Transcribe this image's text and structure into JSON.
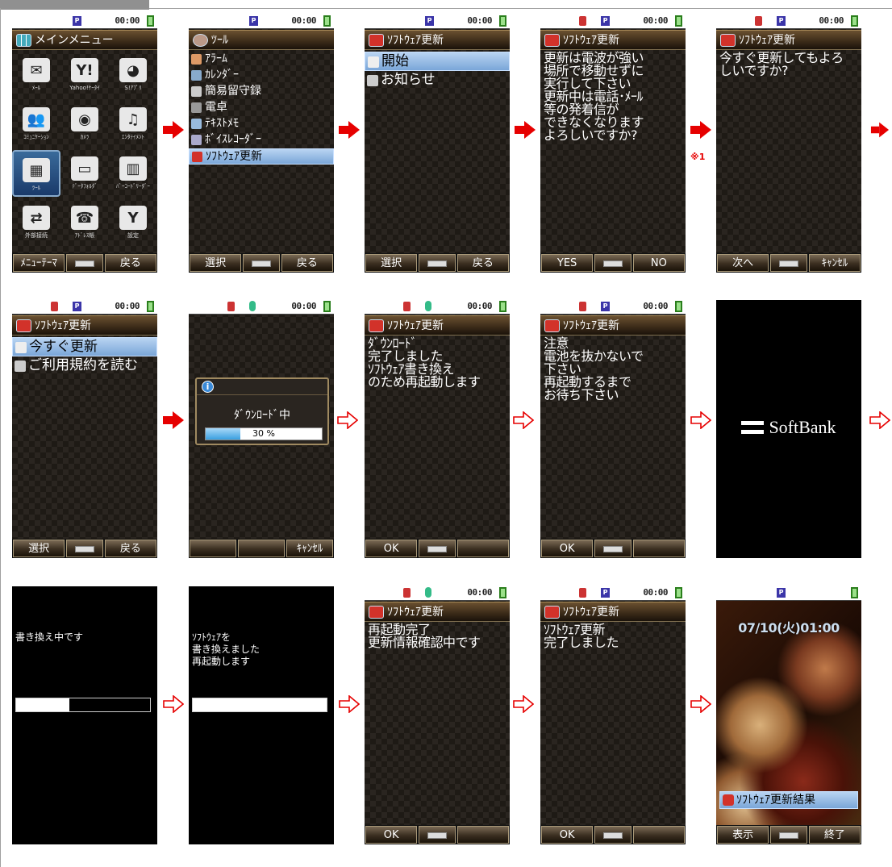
{
  "status": {
    "time": "00:00"
  },
  "screens": {
    "s1": {
      "title": "メインメニュー",
      "items": [
        {
          "label": "ﾒｰﾙ",
          "icon": "envelope-icon",
          "glyph": "✉"
        },
        {
          "label": "Yahoo!ｹｰﾀｲ",
          "icon": "yahoo-icon",
          "glyph": "Y!"
        },
        {
          "label": "S!ｱﾌﾟﾘ",
          "icon": "gamepad-icon",
          "glyph": "◕"
        },
        {
          "label": "ｺﾐｭﾆｹｰｼｮﾝ",
          "icon": "people-icon",
          "glyph": "👥"
        },
        {
          "label": "ｶﾒﾗ",
          "icon": "camera-icon",
          "glyph": "◉"
        },
        {
          "label": "ｴﾝﾀﾃｲﾒﾝﾄ",
          "icon": "headphones-icon",
          "glyph": "♫"
        },
        {
          "label": "ﾂｰﾙ",
          "icon": "tool-icon",
          "glyph": "▦"
        },
        {
          "label": "ﾃﾞｰﾀﾌｫﾙﾀﾞ",
          "icon": "folder-icon",
          "glyph": "▭"
        },
        {
          "label": "ﾊﾞｰｺｰﾄﾞﾘｰﾀﾞｰ",
          "icon": "barcode-icon",
          "glyph": "▥"
        },
        {
          "label": "外部接続",
          "icon": "transfer-icon",
          "glyph": "⇄"
        },
        {
          "label": "ｱﾄﾞﾚｽ帳",
          "icon": "addressbook-icon",
          "glyph": "☎"
        },
        {
          "label": "設定",
          "icon": "wrench-icon",
          "glyph": "Y"
        }
      ],
      "softkeys": [
        "ﾒﾆｭｰﾃｰﾏ",
        "",
        "戻る"
      ]
    },
    "s2": {
      "title": "ﾂｰﾙ",
      "items": [
        "ｱﾗｰﾑ",
        "ｶﾚﾝﾀﾞｰ",
        "簡易留守録",
        "電卓",
        "ﾃｷｽﾄﾒﾓ",
        "ﾎﾞｲｽﾚｺｰﾀﾞｰ",
        "ｿﾌﾄｳｪｱ更新"
      ],
      "softkeys": [
        "選択",
        "",
        "戻る"
      ]
    },
    "s3": {
      "title": "ｿﾌﾄｳｪｱ更新",
      "items": [
        "開始",
        "お知らせ"
      ],
      "softkeys": [
        "選択",
        "",
        "戻る"
      ]
    },
    "s4": {
      "title": "ｿﾌﾄｳｪｱ更新",
      "body": "更新は電波が強い\n場所で移動せずに\n実行して下さい\n更新中は電話･ﾒｰﾙ\n等の発着信が\nできなくなります\nよろしいですか?",
      "softkeys": [
        "YES",
        "",
        "NO"
      ]
    },
    "s5": {
      "title": "ｿﾌﾄｳｪｱ更新",
      "body": "今すぐ更新してもよろ\nしいですか?",
      "softkeys": [
        "次へ",
        "",
        "ｷｬﾝｾﾙ"
      ]
    },
    "s6": {
      "title": "ｿﾌﾄｳｪｱ更新",
      "items": [
        "今すぐ更新",
        "ご利用規約を読む"
      ],
      "softkeys": [
        "選択",
        "",
        "戻る"
      ]
    },
    "s7": {
      "dialog_message": "ﾀﾞｳﾝﾛｰﾄﾞ中",
      "progress_text": "30 %",
      "progress": 0.3,
      "softkeys": [
        "",
        "",
        "ｷｬﾝｾﾙ"
      ]
    },
    "s8": {
      "title": "ｿﾌﾄｳｪｱ更新",
      "body": "ﾀﾞｳﾝﾛｰﾄﾞ\n完了しました\nｿﾌﾄｳｪｱ書き換え\nのため再起動します",
      "softkeys": [
        "OK",
        "",
        ""
      ]
    },
    "s9": {
      "title": "ｿﾌﾄｳｪｱ更新",
      "body": "注意\n電池を抜かないで\n下さい\n再起動するまで\nお待ち下さい",
      "softkeys": [
        "OK",
        "",
        ""
      ]
    },
    "s10": {
      "logo": "SoftBank"
    },
    "s11": {
      "body": "書き換え中です",
      "progress": 0.4
    },
    "s12": {
      "body": "ｿﾌﾄｳｪｱを\n書き換えました\n再起動します",
      "progress": 1.0
    },
    "s13": {
      "title": "ｿﾌﾄｳｪｱ更新",
      "body": "再起動完了\n更新情報確認中です",
      "softkeys": [
        "OK",
        "",
        ""
      ]
    },
    "s14": {
      "title": "ｿﾌﾄｳｪｱ更新",
      "body": "ｿﾌﾄｳｪｱ更新\n完了しました",
      "softkeys": [
        "OK",
        "",
        ""
      ]
    },
    "s15": {
      "clock": "07/10(火)01:00",
      "result_item": "ｿﾌﾄｳｪｱ更新結果",
      "softkeys": [
        "表示",
        "",
        "終了"
      ]
    }
  },
  "note": "※1",
  "colors": {
    "arrow": "#e60000",
    "selection": "#9cc0ea",
    "brown": "#3a2a18"
  }
}
